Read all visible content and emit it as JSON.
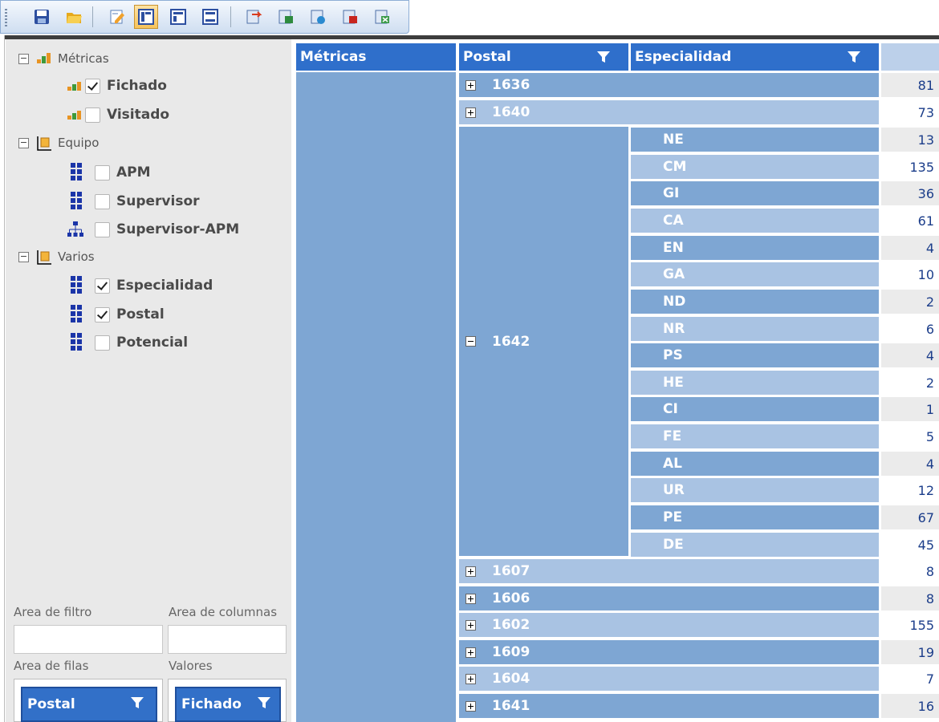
{
  "toolbar": {
    "buttons": [
      "save-icon",
      "open-folder-icon",
      "edit-icon",
      "layout-compact-icon",
      "layout-outline-icon",
      "layout-tabular-icon",
      "export-icon",
      "export-xls-icon",
      "export-csv-icon",
      "export-pdf-icon",
      "export-xml-icon"
    ]
  },
  "field_list": {
    "groups": [
      {
        "label": "Métricas",
        "fields": [
          {
            "label": "Fichado",
            "checked": true
          },
          {
            "label": "Visitado",
            "checked": false
          }
        ]
      },
      {
        "label": "Equipo",
        "fields": [
          {
            "label": "APM",
            "checked": false
          },
          {
            "label": "Supervisor",
            "checked": false
          },
          {
            "label": "Supervisor-APM",
            "checked": false
          }
        ]
      },
      {
        "label": "Varios",
        "fields": [
          {
            "label": "Especialidad",
            "checked": true
          },
          {
            "label": "Postal",
            "checked": true
          },
          {
            "label": "Potencial",
            "checked": false
          }
        ]
      }
    ],
    "areas": {
      "filter_label": "Area de filtro",
      "columns_label": "Area de columnas",
      "rows_label": "Area de filas",
      "values_label": "Valores",
      "rows_chip": "Postal",
      "values_chip": "Fichado"
    }
  },
  "grid": {
    "headers": {
      "metricas": "Métricas",
      "postal": "Postal",
      "especialidad": "Especialidad"
    },
    "postal_rows_top": [
      {
        "postal": "1636",
        "value": "81"
      },
      {
        "postal": "1640",
        "value": "73"
      }
    ],
    "expanded_postal": "1642",
    "especialidad_rows": [
      {
        "esp": "NE",
        "value": "13"
      },
      {
        "esp": "CM",
        "value": "135"
      },
      {
        "esp": "GI",
        "value": "36"
      },
      {
        "esp": "CA",
        "value": "61"
      },
      {
        "esp": "EN",
        "value": "4"
      },
      {
        "esp": "GA",
        "value": "10"
      },
      {
        "esp": "ND",
        "value": "2"
      },
      {
        "esp": "NR",
        "value": "6"
      },
      {
        "esp": "PS",
        "value": "4"
      },
      {
        "esp": "HE",
        "value": "2"
      },
      {
        "esp": "CI",
        "value": "1"
      },
      {
        "esp": "FE",
        "value": "5"
      },
      {
        "esp": "AL",
        "value": "4"
      },
      {
        "esp": "UR",
        "value": "12"
      },
      {
        "esp": "PE",
        "value": "67"
      },
      {
        "esp": "DE",
        "value": "45"
      }
    ],
    "postal_rows_bottom": [
      {
        "postal": "1607",
        "value": "8"
      },
      {
        "postal": "1606",
        "value": "8"
      },
      {
        "postal": "1602",
        "value": "155"
      },
      {
        "postal": "1609",
        "value": "19"
      },
      {
        "postal": "1604",
        "value": "7"
      },
      {
        "postal": "1641",
        "value": "16"
      }
    ]
  },
  "colors": {
    "header_blue": "#2f6fcb",
    "row_dark": "#7ea6d3",
    "row_light": "#a9c3e3",
    "value_text": "#1b3d8a"
  }
}
